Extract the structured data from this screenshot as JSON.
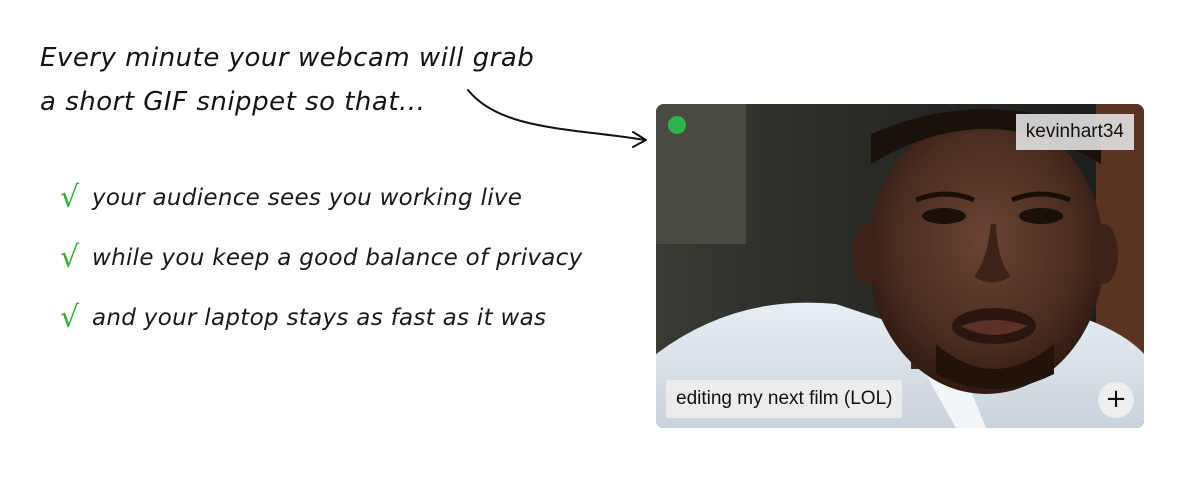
{
  "headline": {
    "line1": "Every minute your webcam will grab",
    "line2": "a short GIF snippet so that..."
  },
  "checklist": {
    "mark": "√",
    "items": [
      "your audience sees you working live",
      "while you keep a good balance of privacy",
      "and your laptop stays as fast as it was"
    ]
  },
  "card": {
    "username": "kevinhart34",
    "caption": "editing my next film (LOL)",
    "plus": "+",
    "live_dot_color": "#2db34a"
  }
}
